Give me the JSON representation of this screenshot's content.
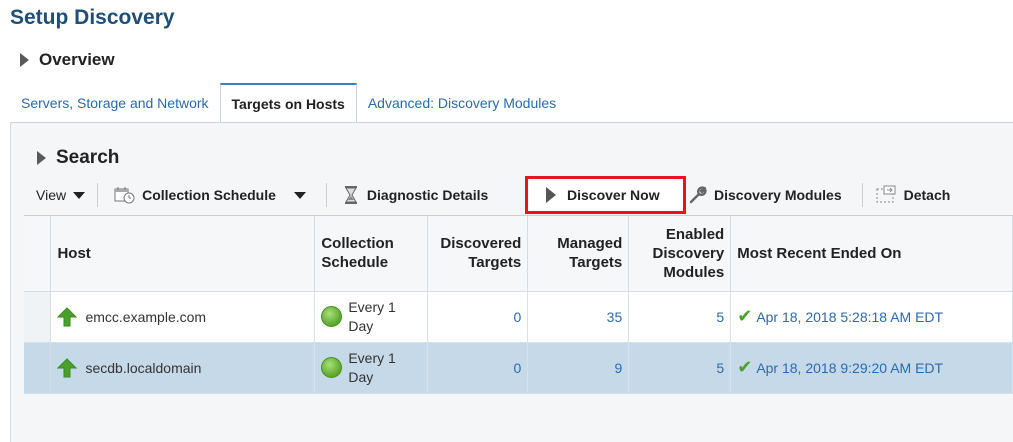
{
  "page": {
    "title": "Setup Discovery"
  },
  "overview": {
    "label": "Overview"
  },
  "tabs": [
    {
      "label": "Servers, Storage and Network"
    },
    {
      "label": "Targets on Hosts"
    },
    {
      "label": "Advanced: Discovery Modules"
    }
  ],
  "search": {
    "label": "Search"
  },
  "toolbar": {
    "view": "View",
    "collection_schedule": "Collection Schedule",
    "diagnostic_details": "Diagnostic Details",
    "discover_now": "Discover Now",
    "discovery_modules": "Discovery Modules",
    "detach": "Detach"
  },
  "table": {
    "headers": {
      "host": "Host",
      "schedule_1": "Collection",
      "schedule_2": "Schedule",
      "discovered_1": "Discovered",
      "discovered_2": "Targets",
      "managed_1": "Managed",
      "managed_2": "Targets",
      "enabled_1": "Enabled",
      "enabled_2": "Discovery",
      "enabled_3": "Modules",
      "recent": "Most Recent Ended On"
    },
    "rows": [
      {
        "host": "emcc.example.com",
        "schedule_1": "Every 1",
        "schedule_2": "Day",
        "discovered": "0",
        "managed": "35",
        "enabled": "5",
        "recent": "Apr 18, 2018 5:28:18 AM EDT"
      },
      {
        "host": "secdb.localdomain",
        "schedule_1": "Every 1",
        "schedule_2": "Day",
        "discovered": "0",
        "managed": "9",
        "enabled": "5",
        "recent": "Apr 18, 2018 9:29:20 AM EDT"
      }
    ]
  },
  "colors": {
    "title": "#1f4e79",
    "link": "#2a6ab0",
    "highlight_border": "#e8141b",
    "selected_row": "#c6d9e8",
    "status_up": "#4aa02c"
  },
  "icons": {
    "overview": "disclosure-triangle-icon",
    "search": "disclosure-triangle-icon",
    "collection_schedule": "calendar-clock-icon",
    "diagnostic_details": "hourglass-icon",
    "discover_now": "play-icon",
    "discovery_modules": "wrench-icon",
    "detach": "detach-icon",
    "host_status": "arrow-up-icon",
    "schedule_status": "green-dot-icon",
    "recent_status": "checkmark-icon"
  }
}
